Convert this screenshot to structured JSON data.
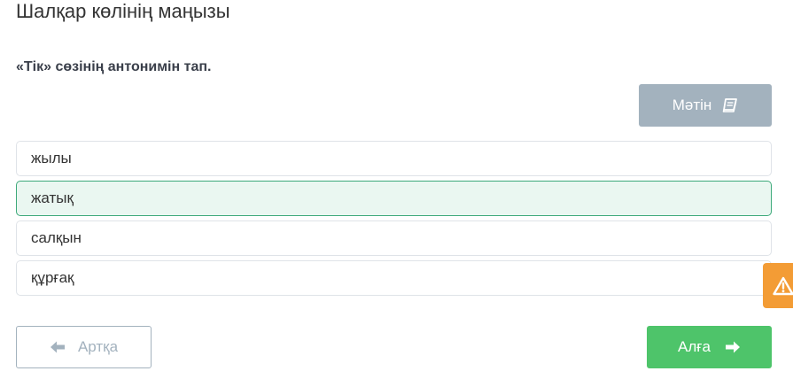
{
  "page": {
    "title": "Шалқар көлінің маңызы"
  },
  "question": {
    "text": "«Тік» сөзінің антонимін тап."
  },
  "text_button": {
    "label": "Мәтін",
    "icon": "book-icon"
  },
  "options": [
    {
      "label": "жылы",
      "selected": false
    },
    {
      "label": "жатық",
      "selected": true
    },
    {
      "label": "салқын",
      "selected": false
    },
    {
      "label": "құрғақ",
      "selected": false
    }
  ],
  "report_tab": {
    "icon": "warning-icon"
  },
  "navigation": {
    "back_label": "Артқа",
    "next_label": "Алға",
    "back_icon": "arrow-left-icon",
    "next_icon": "arrow-right-icon"
  },
  "colors": {
    "selected_bg": "#eaf7f1",
    "selected_border": "#3da97a",
    "next_button": "#4ec46a",
    "text_button": "#a3b2be",
    "warning": "#f39c35"
  }
}
